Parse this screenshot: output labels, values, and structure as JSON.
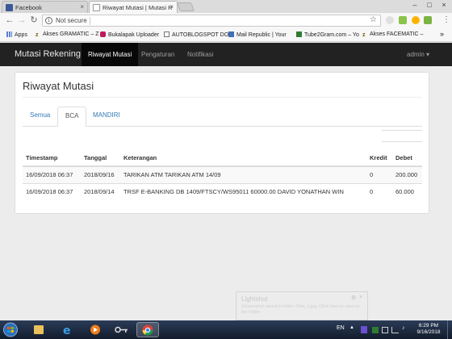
{
  "browser": {
    "tabs": [
      {
        "title": "Facebook",
        "icon": "facebook-icon",
        "color": "#3b5998"
      },
      {
        "title": "Riwayat Mutasi | Mutasi R",
        "icon": "page-icon",
        "color": "#9e9e9e"
      }
    ],
    "close_glyph": "×",
    "omnibox": {
      "secure_label": "Not secure",
      "url": ""
    },
    "bookmarks": [
      {
        "label": "Apps",
        "icon": "apps-grid-icon"
      },
      {
        "label": "Akses GRAMATIC – Z",
        "icon": "z-icon"
      },
      {
        "label": "Bukalapak Uploader",
        "icon": "bukalapak-icon"
      },
      {
        "label": "AUTOBLOGSPOT DO",
        "icon": "page-icon"
      },
      {
        "label": "Mail Republic | Your",
        "icon": "mail-icon"
      },
      {
        "label": "Tube2Gram.com – Yo",
        "icon": "tube2gram-icon"
      },
      {
        "label": "Akses FACEMATIC –",
        "icon": "z-icon"
      }
    ],
    "bookmarks_more": "»"
  },
  "app": {
    "brand": "Mutasi Rekening",
    "nav": [
      "Riwayat Mutasi",
      "Pengaturan",
      "Notifikasi"
    ],
    "user": "admin ▾",
    "page_title": "Riwayat Mutasi",
    "tabs": [
      "Semua",
      "BCA",
      "MANDIRI"
    ],
    "active_tab": "BCA",
    "table": {
      "headers": [
        "Timestamp",
        "Tanggal",
        "Keterangan",
        "Kredit",
        "Debet"
      ],
      "rows": [
        [
          "16/09/2018 06:37",
          "2018/09/16",
          "TARIKAN ATM TARIKAN ATM 14/09",
          "0",
          "200.000"
        ],
        [
          "16/09/2018 06:37",
          "2018/09/14",
          "TRSF E-BANKING DB 1409/FTSCY/WS95011 60000.00 DAVID YONATHAN WIN",
          "0",
          "60.000"
        ]
      ]
    }
  },
  "toast": {
    "title": "Lightshot",
    "body": "Screenshot saved to folder Shot_1.jpg. Click here to open in the folder."
  },
  "taskbar": {
    "items": [
      "start-orb-icon",
      "explorer-folder-icon",
      "internet-explorer-icon",
      "media-player-icon",
      "key-icon",
      "chrome-icon"
    ],
    "tray_lang": "EN",
    "clock_time": "6:29 PM",
    "clock_date": "9/16/2018"
  },
  "colors": {
    "navbar": "#222222",
    "link": "#337ab7",
    "chrome": "#4caf50"
  }
}
